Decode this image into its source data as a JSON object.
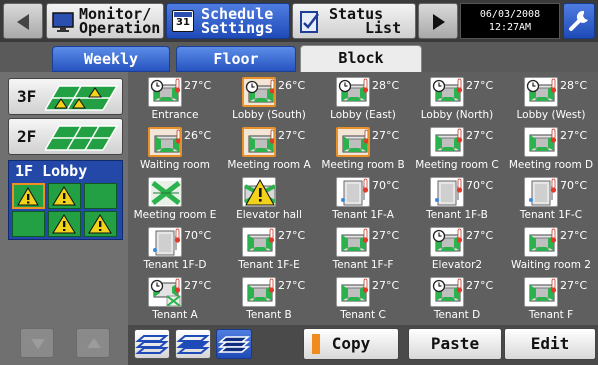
{
  "header": {
    "monitor_line1": "Monitor/",
    "monitor_line2": "Operation",
    "schedule_line1": "Schedule",
    "schedule_line2": "Settings",
    "schedule_icon_text": "31",
    "status_line1": "Status",
    "status_line2": "List",
    "date": "06/03/2008",
    "time": "12:27AM"
  },
  "tabs": [
    {
      "label": "Weekly",
      "selected": false
    },
    {
      "label": "Floor",
      "selected": false
    },
    {
      "label": "Block",
      "selected": true
    }
  ],
  "floors": [
    {
      "label": "3F"
    },
    {
      "label": "2F"
    }
  ],
  "selected_block": {
    "label": "1F Lobby",
    "mini_cells": [
      "warning",
      "warning",
      "normal",
      "normal",
      "warning",
      "warning"
    ]
  },
  "units": [
    {
      "name": "Entrance",
      "temp": "27°C",
      "type": "cassette",
      "selected": false,
      "timer": true
    },
    {
      "name": "Lobby (South)",
      "temp": "26°C",
      "type": "cassette",
      "selected": true,
      "timer": true
    },
    {
      "name": "Lobby (East)",
      "temp": "28°C",
      "type": "cassette",
      "selected": false,
      "timer": true
    },
    {
      "name": "Lobby (North)",
      "temp": "27°C",
      "type": "cassette",
      "selected": false,
      "timer": true
    },
    {
      "name": "Lobby (West)",
      "temp": "28°C",
      "type": "cassette",
      "selected": false,
      "timer": true
    },
    {
      "name": "Waiting room",
      "temp": "26°C",
      "type": "cassette",
      "selected": true,
      "timer": false
    },
    {
      "name": "Meeting room A",
      "temp": "27°C",
      "type": "cassette",
      "selected": true,
      "timer": false
    },
    {
      "name": "Meeting room B",
      "temp": "27°C",
      "type": "cassette",
      "selected": true,
      "timer": false
    },
    {
      "name": "Meeting room C",
      "temp": "27°C",
      "type": "cassette",
      "selected": false,
      "timer": false
    },
    {
      "name": "Meeting room D",
      "temp": "27°C",
      "type": "cassette",
      "selected": false,
      "timer": false
    },
    {
      "name": "Meeting room E",
      "temp": "",
      "type": "ventilator",
      "selected": false,
      "timer": false
    },
    {
      "name": "Elevator hall",
      "temp": "",
      "type": "warning",
      "selected": false,
      "timer": false
    },
    {
      "name": "Tenant 1F-A",
      "temp": "70°C",
      "type": "heater",
      "selected": false,
      "timer": false
    },
    {
      "name": "Tenant 1F-B",
      "temp": "70°C",
      "type": "heater",
      "selected": false,
      "timer": false
    },
    {
      "name": "Tenant 1F-C",
      "temp": "70°C",
      "type": "heater",
      "selected": false,
      "timer": false
    },
    {
      "name": "Tenant 1F-D",
      "temp": "70°C",
      "type": "heater",
      "selected": false,
      "timer": false
    },
    {
      "name": "Tenant 1F-E",
      "temp": "27°C",
      "type": "cassette",
      "selected": false,
      "timer": false
    },
    {
      "name": "Tenant 1F-F",
      "temp": "27°C",
      "type": "cassette",
      "selected": false,
      "timer": false
    },
    {
      "name": "Elevator2",
      "temp": "27°C",
      "type": "cassette",
      "selected": false,
      "timer": true
    },
    {
      "name": "Waiting room 2",
      "temp": "27°C",
      "type": "cassette",
      "selected": false,
      "timer": false
    },
    {
      "name": "Tenant A",
      "temp": "27°C",
      "type": "cassette-vent",
      "selected": false,
      "timer": true
    },
    {
      "name": "Tenant B",
      "temp": "27°C",
      "type": "cassette",
      "selected": false,
      "timer": false
    },
    {
      "name": "Tenant C",
      "temp": "27°C",
      "type": "cassette",
      "selected": false,
      "timer": false
    },
    {
      "name": "Tenant D",
      "temp": "27°C",
      "type": "cassette",
      "selected": false,
      "timer": true
    },
    {
      "name": "Tenant F",
      "temp": "27°C",
      "type": "cassette",
      "selected": false,
      "timer": false
    }
  ],
  "actions": {
    "copy": "Copy",
    "paste": "Paste",
    "edit": "Edit"
  },
  "colors": {
    "accent_blue": "#2753c0",
    "selection_orange": "#e8902a",
    "status_green": "#22a043",
    "warning_yellow": "#f2d21a"
  }
}
